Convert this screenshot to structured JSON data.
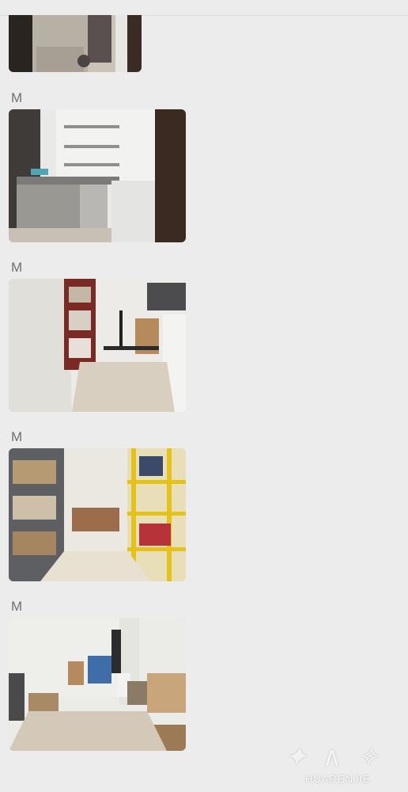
{
  "messages": [
    {
      "sender": ""
    },
    {
      "sender": "M"
    },
    {
      "sender": "M"
    },
    {
      "sender": "M"
    },
    {
      "sender": "M"
    }
  ],
  "watermark": {
    "text": "HUARENJIE"
  },
  "colors": {
    "background": "#ececec",
    "sender_text": "#6f6f6f"
  }
}
